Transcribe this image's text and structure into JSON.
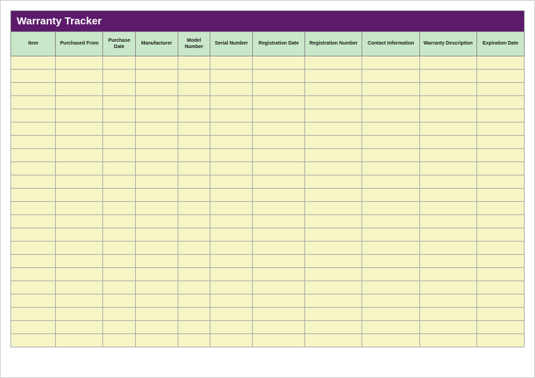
{
  "title": "Warranty Tracker",
  "columns": [
    "Item",
    "Purchased From",
    "Purchase Date",
    "Manufacturer",
    "Model Number",
    "Serial Number",
    "Registration Date",
    "Registration Number",
    "Contact Information",
    "Warranty Description",
    "Expiration Date"
  ],
  "rows": [
    [
      "",
      "",
      "",
      "",
      "",
      "",
      "",
      "",
      "",
      "",
      ""
    ],
    [
      "",
      "",
      "",
      "",
      "",
      "",
      "",
      "",
      "",
      "",
      ""
    ],
    [
      "",
      "",
      "",
      "",
      "",
      "",
      "",
      "",
      "",
      "",
      ""
    ],
    [
      "",
      "",
      "",
      "",
      "",
      "",
      "",
      "",
      "",
      "",
      ""
    ],
    [
      "",
      "",
      "",
      "",
      "",
      "",
      "",
      "",
      "",
      "",
      ""
    ],
    [
      "",
      "",
      "",
      "",
      "",
      "",
      "",
      "",
      "",
      "",
      ""
    ],
    [
      "",
      "",
      "",
      "",
      "",
      "",
      "",
      "",
      "",
      "",
      ""
    ],
    [
      "",
      "",
      "",
      "",
      "",
      "",
      "",
      "",
      "",
      "",
      ""
    ],
    [
      "",
      "",
      "",
      "",
      "",
      "",
      "",
      "",
      "",
      "",
      ""
    ],
    [
      "",
      "",
      "",
      "",
      "",
      "",
      "",
      "",
      "",
      "",
      ""
    ],
    [
      "",
      "",
      "",
      "",
      "",
      "",
      "",
      "",
      "",
      "",
      ""
    ],
    [
      "",
      "",
      "",
      "",
      "",
      "",
      "",
      "",
      "",
      "",
      ""
    ],
    [
      "",
      "",
      "",
      "",
      "",
      "",
      "",
      "",
      "",
      "",
      ""
    ],
    [
      "",
      "",
      "",
      "",
      "",
      "",
      "",
      "",
      "",
      "",
      ""
    ],
    [
      "",
      "",
      "",
      "",
      "",
      "",
      "",
      "",
      "",
      "",
      ""
    ],
    [
      "",
      "",
      "",
      "",
      "",
      "",
      "",
      "",
      "",
      "",
      ""
    ],
    [
      "",
      "",
      "",
      "",
      "",
      "",
      "",
      "",
      "",
      "",
      ""
    ],
    [
      "",
      "",
      "",
      "",
      "",
      "",
      "",
      "",
      "",
      "",
      ""
    ],
    [
      "",
      "",
      "",
      "",
      "",
      "",
      "",
      "",
      "",
      "",
      ""
    ],
    [
      "",
      "",
      "",
      "",
      "",
      "",
      "",
      "",
      "",
      "",
      ""
    ],
    [
      "",
      "",
      "",
      "",
      "",
      "",
      "",
      "",
      "",
      "",
      ""
    ],
    [
      "",
      "",
      "",
      "",
      "",
      "",
      "",
      "",
      "",
      "",
      ""
    ]
  ]
}
